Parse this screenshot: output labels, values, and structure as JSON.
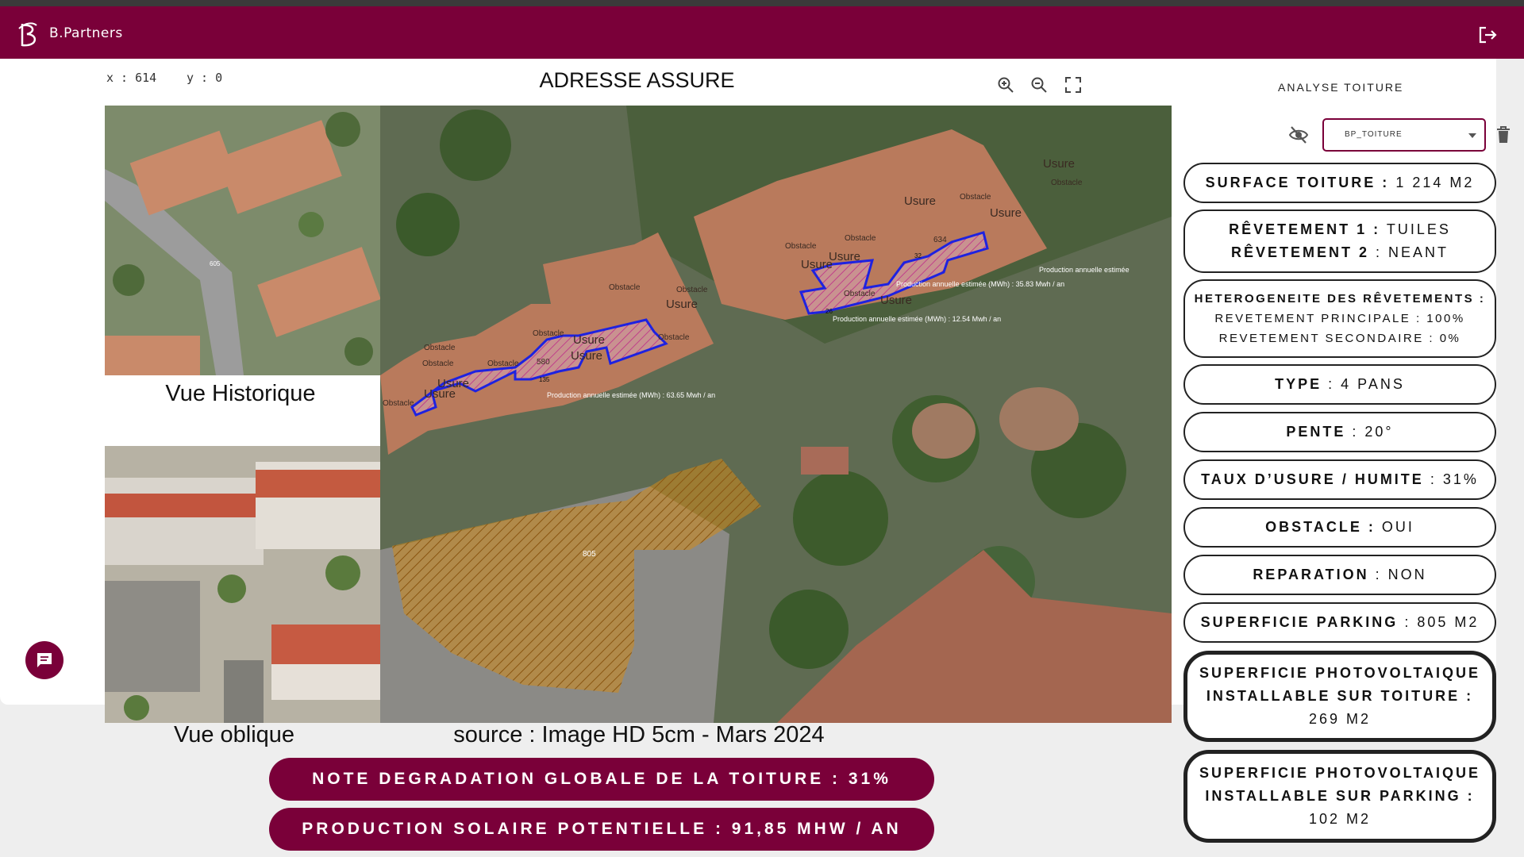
{
  "app": {
    "brand": "B.Partners"
  },
  "colors": {
    "brand": "#7a0039",
    "blue_zone": "#1e22e0",
    "orange_zone": "#d98a1a"
  },
  "icons": {
    "logout": "logout-icon",
    "zoom_in": "zoom-in-icon",
    "zoom_out": "zoom-out-icon",
    "fullscreen": "fullscreen-icon",
    "visibility": "eye-off-icon",
    "delete": "trash-icon",
    "chat": "chat-icon"
  },
  "coords": {
    "x_label": "x :",
    "x_value": "614",
    "y_label": "y :",
    "y_value": "0"
  },
  "main": {
    "title": "ADRESSE ASSURE",
    "source": "source : Image HD 5cm - Mars 2024"
  },
  "side": {
    "historique_label": "Vue Historique",
    "oblique_label": "Vue oblique",
    "parking_value": "605"
  },
  "map": {
    "annotations": [
      {
        "text": "Usure"
      },
      {
        "text": "Usure"
      },
      {
        "text": "Usure"
      },
      {
        "text": "Usure"
      },
      {
        "text": "Obstacle"
      },
      {
        "text": "Obstacle"
      },
      {
        "text": "Obstacle"
      },
      {
        "text": "Obstacle"
      },
      {
        "text": "Obstacle"
      },
      {
        "text": "Obstacle"
      },
      {
        "text": "Obstacle"
      },
      {
        "text": "Obstacle"
      },
      {
        "text": "Usure"
      },
      {
        "text": "Usure"
      },
      {
        "text": "Obstacle"
      },
      {
        "text": "Usure"
      },
      {
        "text": "Obstacle"
      },
      {
        "text": "Usure"
      },
      {
        "text": "Obstacle"
      },
      {
        "text": "Usure"
      },
      {
        "text": "Usure"
      },
      {
        "text": "Usure"
      },
      {
        "text": "Obstacle"
      },
      {
        "text": "Obstacle"
      },
      {
        "text": "634"
      },
      {
        "text": "580"
      }
    ],
    "zone_labels": [
      {
        "id": "135",
        "production": "Production annuelle estimée (MWh) : 63.65 Mwh / an"
      },
      {
        "id": "26",
        "production": "Production annuelle estimée (MWh) : 12.54 Mwh / an"
      },
      {
        "id": "32",
        "production": "Production annuelle estimée (MWh) : 35.83 Mwh / an"
      },
      {
        "id": "",
        "production": "Production annuelle estimée"
      }
    ],
    "parking_label": "805"
  },
  "analyse": {
    "tab_label": "ANALYSE TOITURE",
    "layer_select_value": "BP_TOITURE",
    "cards": [
      {
        "lines": [
          {
            "label": "SURFACE TOITURE :",
            "value": " 1 214 M2"
          }
        ]
      },
      {
        "lines": [
          {
            "label": "RÊVETEMENT 1 :",
            "value": " TUILES"
          },
          {
            "label": "RÊVETEMENT 2",
            "value": " : NEANT"
          }
        ]
      },
      {
        "lines": [
          {
            "label": "HETEROGENEITE DES RÊVETEMENTS :",
            "value": ""
          },
          {
            "label": "",
            "value": "REVETEMENT PRINCIPALE : 100%"
          },
          {
            "label": "",
            "value": "REVETEMENT SECONDAIRE : 0%"
          }
        ]
      },
      {
        "lines": [
          {
            "label": "TYPE",
            "value": " : 4 PANS"
          }
        ]
      },
      {
        "lines": [
          {
            "label": "PENTE",
            "value": " : 20°"
          }
        ]
      },
      {
        "lines": [
          {
            "label": "TAUX D’USURE / HUMITE",
            "value": " : 31%"
          }
        ]
      },
      {
        "lines": [
          {
            "label": "OBSTACLE :",
            "value": " OUI"
          }
        ]
      },
      {
        "lines": [
          {
            "label": "REPARATION",
            "value": " : NON"
          }
        ]
      },
      {
        "lines": [
          {
            "label": "SUPERFICIE PARKING",
            "value": " : 805 M2"
          }
        ]
      },
      {
        "lines": [
          {
            "label": "SUPERFICIE PHOTOVOLTAIQUE",
            "value": ""
          },
          {
            "label": "INSTALLABLE SUR TOITURE :",
            "value": ""
          },
          {
            "label": "",
            "value": "269 M2"
          }
        ]
      },
      {
        "lines": [
          {
            "label": "SUPERFICIE PHOTOVOLTAIQUE",
            "value": ""
          },
          {
            "label": "INSTALLABLE SUR PARKING :",
            "value": ""
          },
          {
            "label": "",
            "value": "102 M2"
          }
        ]
      }
    ]
  },
  "summary": {
    "note_degradation": "NOTE DEGRADATION GLOBALE DE LA TOITURE : 31%",
    "production_solaire": "PRODUCTION SOLAIRE POTENTIELLE : 91,85 MHW / AN"
  }
}
